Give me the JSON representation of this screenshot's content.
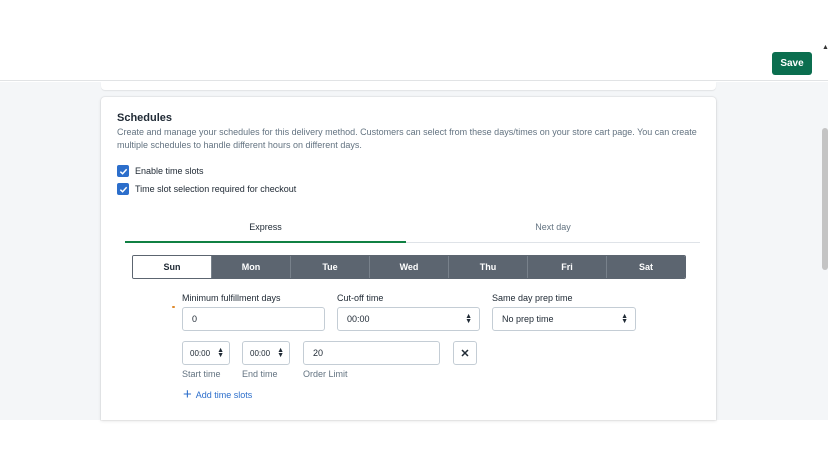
{
  "topbar": {
    "save_label": "Save"
  },
  "schedules": {
    "title": "Schedules",
    "description": "Create and manage your schedules for this delivery method. Customers can select from these days/times on your store cart page. You can create multiple schedules to handle different hours on different days.",
    "checkboxes": [
      {
        "label": "Enable time slots",
        "checked": true
      },
      {
        "label": "Time slot selection required for checkout",
        "checked": true
      }
    ],
    "tabs": [
      {
        "label": "Express",
        "active": true
      },
      {
        "label": "Next day",
        "active": false
      }
    ],
    "days": [
      {
        "label": "Sun",
        "active": true
      },
      {
        "label": "Mon",
        "active": false
      },
      {
        "label": "Tue",
        "active": false
      },
      {
        "label": "Wed",
        "active": false
      },
      {
        "label": "Thu",
        "active": false
      },
      {
        "label": "Fri",
        "active": false
      },
      {
        "label": "Sat",
        "active": false
      }
    ],
    "fields": {
      "min_fulfillment": {
        "label": "Minimum fulfillment days",
        "value": "0"
      },
      "cutoff": {
        "label": "Cut-off time",
        "value": "00:00"
      },
      "prep": {
        "label": "Same day prep time",
        "value": "No prep time"
      }
    },
    "slot": {
      "start_value": "00:00",
      "start_label": "Start time",
      "end_value": "00:00",
      "end_label": "End time",
      "limit_value": "20",
      "limit_label": "Order Limit",
      "remove_symbol": "✕"
    },
    "add_slots_label": "Add time slots",
    "add_symbol": "+"
  },
  "colors": {
    "accent": "#0b6e4f",
    "tab_underline": "#108043",
    "day_bg": "#5c6570",
    "link": "#2c6ecb"
  }
}
